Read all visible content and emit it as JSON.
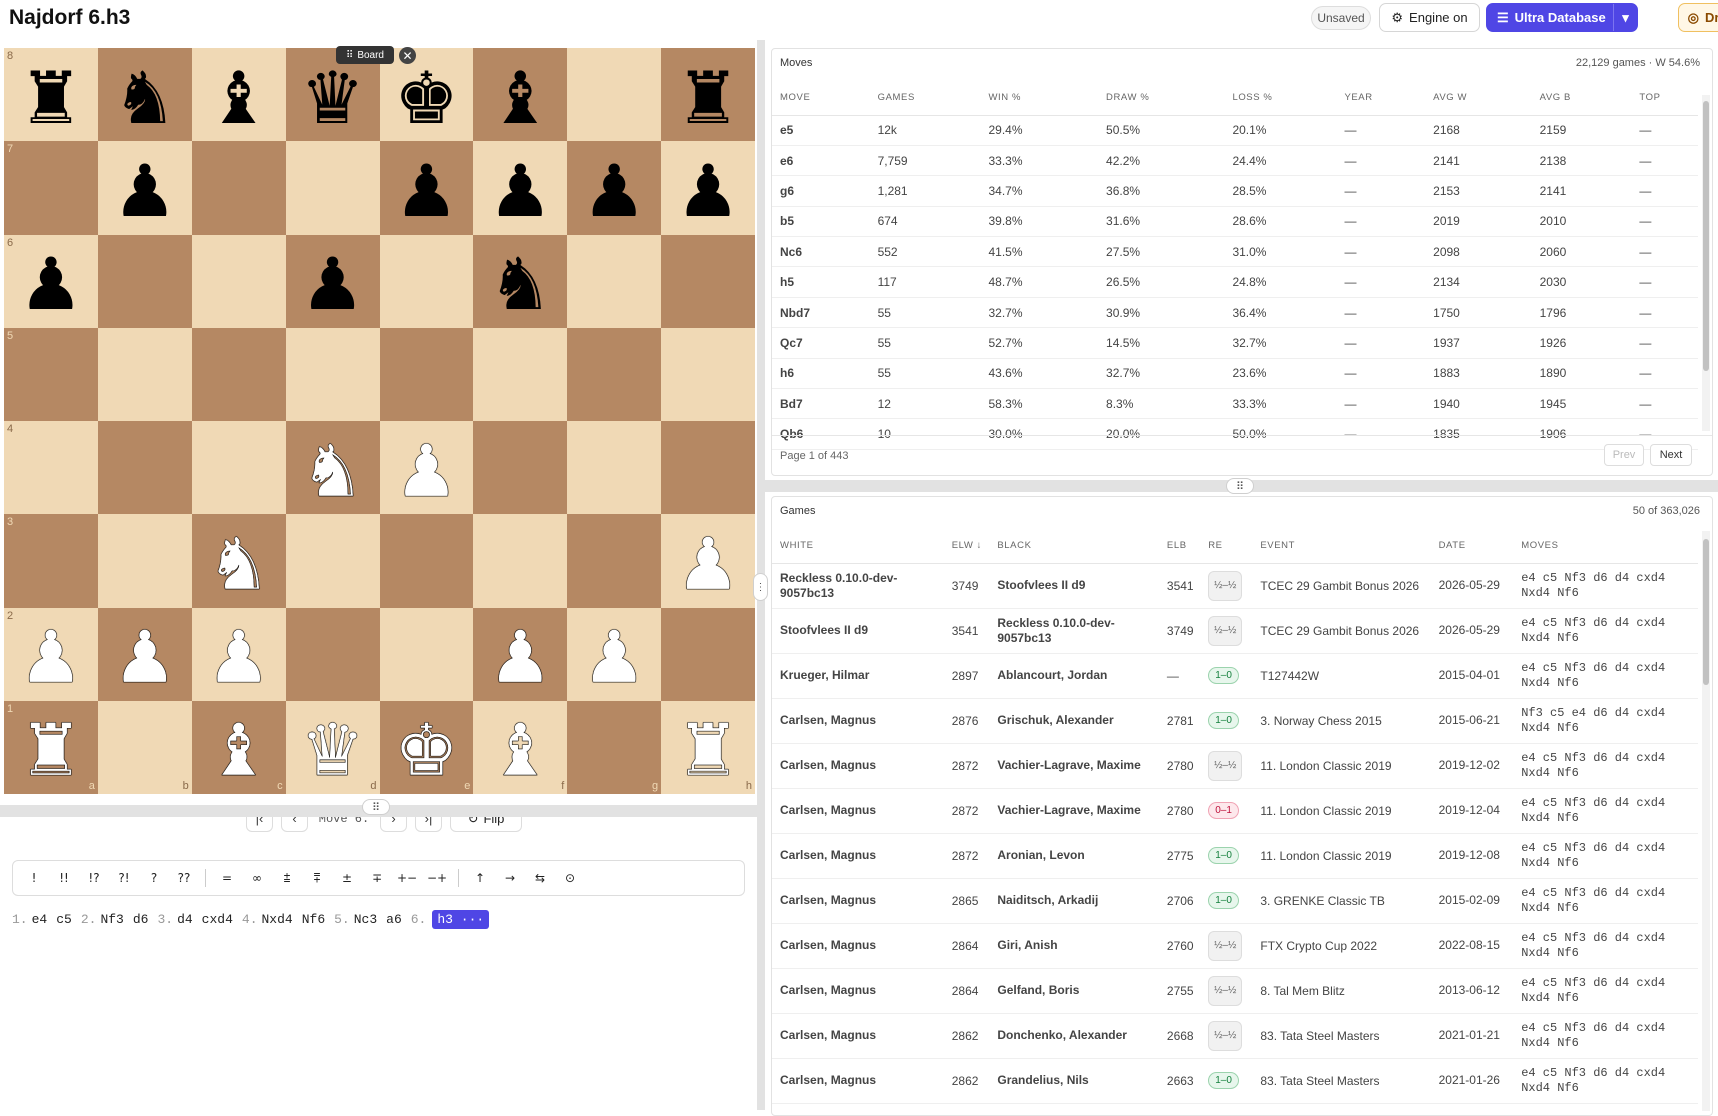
{
  "header": {
    "title": "Najdorf 6.h3",
    "unsaved": "Unsaved",
    "engine": "Engine on",
    "ultra": "Ultra Database",
    "drill": "Drill"
  },
  "board": {
    "tag": "Board",
    "rows": [
      [
        "br",
        "bn",
        "bb",
        "bq",
        "bk",
        "bb",
        "",
        "br"
      ],
      [
        "",
        "bp",
        "",
        "",
        "bp",
        "bp",
        "bp",
        "bp"
      ],
      [
        "bp",
        "",
        "",
        "bp",
        "",
        "bn",
        "",
        ""
      ],
      [
        "",
        "",
        "",
        "",
        "",
        "",
        "",
        ""
      ],
      [
        "",
        "",
        "",
        "wn",
        "wp",
        "",
        "",
        ""
      ],
      [
        "",
        "",
        "wn",
        "",
        "",
        "",
        "",
        "wp"
      ],
      [
        "wp",
        "wp",
        "wp",
        "",
        "",
        "wp",
        "wp",
        ""
      ],
      [
        "wr",
        "",
        "wb",
        "wq",
        "wk",
        "wb",
        "",
        "wr"
      ]
    ],
    "ranks": [
      "8",
      "7",
      "6",
      "5",
      "4",
      "3",
      "2",
      "1"
    ],
    "files": [
      "a",
      "b",
      "c",
      "d",
      "e",
      "f",
      "g",
      "h"
    ]
  },
  "nav": {
    "move_label": "Move 6.",
    "flip": "Flip"
  },
  "annotations": [
    "!",
    "!!",
    "!?",
    "?!",
    "?",
    "??",
    "=",
    "∞",
    "⩲",
    "⩱",
    "±",
    "∓",
    "+−",
    "−+",
    "↑",
    "→",
    "⇆",
    "⊙"
  ],
  "pgn": [
    {
      "num": "1.",
      "w": "e4",
      "b": "c5"
    },
    {
      "num": "2.",
      "w": "Nf3",
      "b": "d6"
    },
    {
      "num": "3.",
      "w": "d4",
      "b": "cxd4"
    },
    {
      "num": "4.",
      "w": "Nxd4",
      "b": "Nf6"
    },
    {
      "num": "5.",
      "w": "Nc3",
      "b": "a6"
    },
    {
      "num": "6.",
      "w": "h3 ···",
      "b": ""
    }
  ],
  "moves_panel": {
    "title": "Moves",
    "info": "22,129 games · W 54.6%",
    "columns": [
      "MOVE",
      "GAMES",
      "WIN %",
      "DRAW %",
      "LOSS %",
      "YEAR",
      "AVG W",
      "AVG B",
      "TOP"
    ],
    "rows": [
      [
        "e5",
        "12k",
        "29.4%",
        "50.5%",
        "20.1%",
        "—",
        "2168",
        "2159",
        "—"
      ],
      [
        "e6",
        "7,759",
        "33.3%",
        "42.2%",
        "24.4%",
        "—",
        "2141",
        "2138",
        "—"
      ],
      [
        "g6",
        "1,281",
        "34.7%",
        "36.8%",
        "28.5%",
        "—",
        "2153",
        "2141",
        "—"
      ],
      [
        "b5",
        "674",
        "39.8%",
        "31.6%",
        "28.6%",
        "—",
        "2019",
        "2010",
        "—"
      ],
      [
        "Nc6",
        "552",
        "41.5%",
        "27.5%",
        "31.0%",
        "—",
        "2098",
        "2060",
        "—"
      ],
      [
        "h5",
        "117",
        "48.7%",
        "26.5%",
        "24.8%",
        "—",
        "2134",
        "2030",
        "—"
      ],
      [
        "Nbd7",
        "55",
        "32.7%",
        "30.9%",
        "36.4%",
        "—",
        "1750",
        "1796",
        "—"
      ],
      [
        "Qc7",
        "55",
        "52.7%",
        "14.5%",
        "32.7%",
        "—",
        "1937",
        "1926",
        "—"
      ],
      [
        "h6",
        "55",
        "43.6%",
        "32.7%",
        "23.6%",
        "—",
        "1883",
        "1890",
        "—"
      ],
      [
        "Bd7",
        "12",
        "58.3%",
        "8.3%",
        "33.3%",
        "—",
        "1940",
        "1945",
        "—"
      ],
      [
        "Qb6",
        "10",
        "30.0%",
        "20.0%",
        "50.0%",
        "—",
        "1835",
        "1906",
        "—"
      ]
    ],
    "page": "Page 1 of 443",
    "prev": "Prev",
    "next": "Next"
  },
  "games_panel": {
    "title": "Games",
    "info": "50 of 363,026",
    "columns": [
      "WHITE",
      "ELW ↓",
      "BLACK",
      "ELB",
      "RE",
      "EVENT",
      "DATE",
      "MOVES"
    ],
    "rows": [
      [
        "Reckless 0.10.0-dev-9057bc13",
        "3749",
        "Stoofvlees II d9",
        "3541",
        "½–½",
        "TCEC 29 Gambit Bonus 2026",
        "2026-05-29",
        "e4 c5 Nf3 d6 d4 cxd4 Nxd4 Nf6"
      ],
      [
        "Stoofvlees II d9",
        "3541",
        "Reckless 0.10.0-dev-9057bc13",
        "3749",
        "½–½",
        "TCEC 29 Gambit Bonus 2026",
        "2026-05-29",
        "e4 c5 Nf3 d6 d4 cxd4 Nxd4 Nf6"
      ],
      [
        "Krueger, Hilmar",
        "2897",
        "Ablancourt, Jordan",
        "—",
        "1–0",
        "T127442W",
        "2015-04-01",
        "e4 c5 Nf3 d6 d4 cxd4 Nxd4 Nf6"
      ],
      [
        "Carlsen, Magnus",
        "2876",
        "Grischuk, Alexander",
        "2781",
        "1–0",
        "3. Norway Chess 2015",
        "2015-06-21",
        "Nf3 c5 e4 d6 d4 cxd4 Nxd4 Nf6"
      ],
      [
        "Carlsen, Magnus",
        "2872",
        "Vachier-Lagrave, Maxime",
        "2780",
        "½–½",
        "11. London Classic 2019",
        "2019-12-02",
        "e4 c5 Nf3 d6 d4 cxd4 Nxd4 Nf6"
      ],
      [
        "Carlsen, Magnus",
        "2872",
        "Vachier-Lagrave, Maxime",
        "2780",
        "0–1",
        "11. London Classic 2019",
        "2019-12-04",
        "e4 c5 Nf3 d6 d4 cxd4 Nxd4 Nf6"
      ],
      [
        "Carlsen, Magnus",
        "2872",
        "Aronian, Levon",
        "2775",
        "1–0",
        "11. London Classic 2019",
        "2019-12-08",
        "e4 c5 Nf3 d6 d4 cxd4 Nxd4 Nf6"
      ],
      [
        "Carlsen, Magnus",
        "2865",
        "Naiditsch, Arkadij",
        "2706",
        "1–0",
        "3. GRENKE Classic TB",
        "2015-02-09",
        "e4 c5 Nf3 d6 d4 cxd4 Nxd4 Nf6"
      ],
      [
        "Carlsen, Magnus",
        "2864",
        "Giri, Anish",
        "2760",
        "½–½",
        "FTX Crypto Cup 2022",
        "2022-08-15",
        "e4 c5 Nf3 d6 d4 cxd4 Nxd4 Nf6"
      ],
      [
        "Carlsen, Magnus",
        "2864",
        "Gelfand, Boris",
        "2755",
        "½–½",
        "8. Tal Mem Blitz",
        "2013-06-12",
        "e4 c5 Nf3 d6 d4 cxd4 Nxd4 Nf6"
      ],
      [
        "Carlsen, Magnus",
        "2862",
        "Donchenko, Alexander",
        "2668",
        "½–½",
        "83. Tata Steel Masters",
        "2021-01-21",
        "e4 c5 Nf3 d6 d4 cxd4 Nxd4 Nf6"
      ],
      [
        "Carlsen, Magnus",
        "2862",
        "Grandelius, Nils",
        "2663",
        "1–0",
        "83. Tata Steel Masters",
        "2021-01-26",
        "e4 c5 Nf3 d6 d4 cxd4 Nxd4 Nf6"
      ]
    ]
  }
}
